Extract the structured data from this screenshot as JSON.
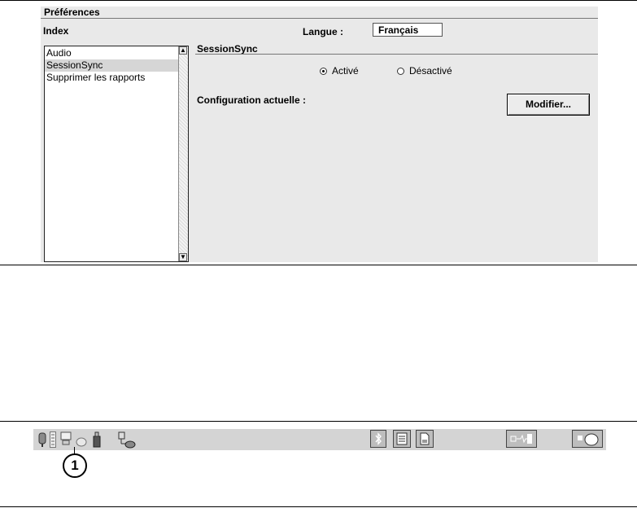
{
  "preferences": {
    "title": "Préférences",
    "index_label": "Index",
    "language_label": "Langue :",
    "language_value": "Français",
    "list_items": [
      {
        "label": "Audio"
      },
      {
        "label": "SessionSync"
      },
      {
        "label": "Supprimer les rapports"
      }
    ],
    "selected_item": "SessionSync",
    "section_title": "SessionSync",
    "radio_on_label": "Activé",
    "radio_off_label": "Désactivé",
    "selected_radio": "Activé",
    "config_label": "Configuration actuelle :",
    "modify_button": "Modifier..."
  },
  "taskbar": {
    "left_icons": [
      "usb-device-icon",
      "battery-icon",
      "computer-icon",
      "disc-icon",
      "memory-stick-icon",
      "network-plug-icon"
    ],
    "right_icons": [
      "bluetooth-icon",
      "document-list-icon",
      "file-icon",
      "waveform-icon",
      "toggle-icon"
    ]
  },
  "callout": {
    "label": "1"
  }
}
